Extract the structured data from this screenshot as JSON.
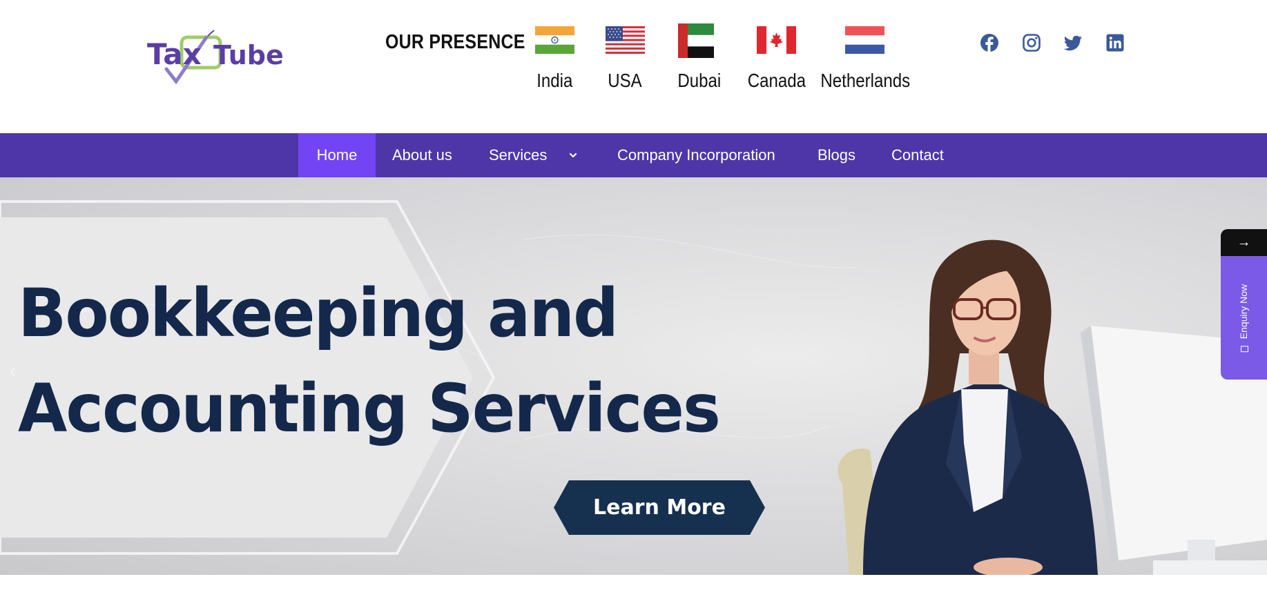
{
  "brand": {
    "logo_text_1": "Tax",
    "logo_text_2": "Tube",
    "logo_colors": {
      "purple": "#5b3ea4",
      "green": "#8fc34f"
    }
  },
  "presence": {
    "label": "OUR PRESENCE",
    "countries": [
      {
        "name": "India",
        "flag": "india-flag"
      },
      {
        "name": "USA",
        "flag": "usa-flag"
      },
      {
        "name": "Dubai",
        "flag": "uae-flag"
      },
      {
        "name": "Canada",
        "flag": "canada-flag"
      },
      {
        "name": "Netherlands",
        "flag": "netherlands-flag"
      }
    ]
  },
  "social": [
    {
      "icon": "facebook-icon"
    },
    {
      "icon": "instagram-icon"
    },
    {
      "icon": "twitter-icon"
    },
    {
      "icon": "linkedin-icon"
    }
  ],
  "nav": {
    "items": [
      {
        "label": "Home",
        "active": true
      },
      {
        "label": "About us"
      },
      {
        "label": "Services",
        "has_dropdown": true
      },
      {
        "label": "Company Incorporation"
      },
      {
        "label": "Blogs"
      },
      {
        "label": "Contact"
      }
    ]
  },
  "hero": {
    "title_line_1": "Bookkeeping and",
    "title_line_2": "Accounting Services",
    "cta_label": "Learn More"
  },
  "enquiry": {
    "arrow": "→",
    "label": "Enquiry Now"
  },
  "colors": {
    "nav_bg": "#4f36a8",
    "nav_active": "#7244f4",
    "hero_title": "#14284b",
    "cta_bg": "#16304f",
    "enquiry_tab": "#7a5ae6",
    "social_icon": "#3b5998"
  }
}
